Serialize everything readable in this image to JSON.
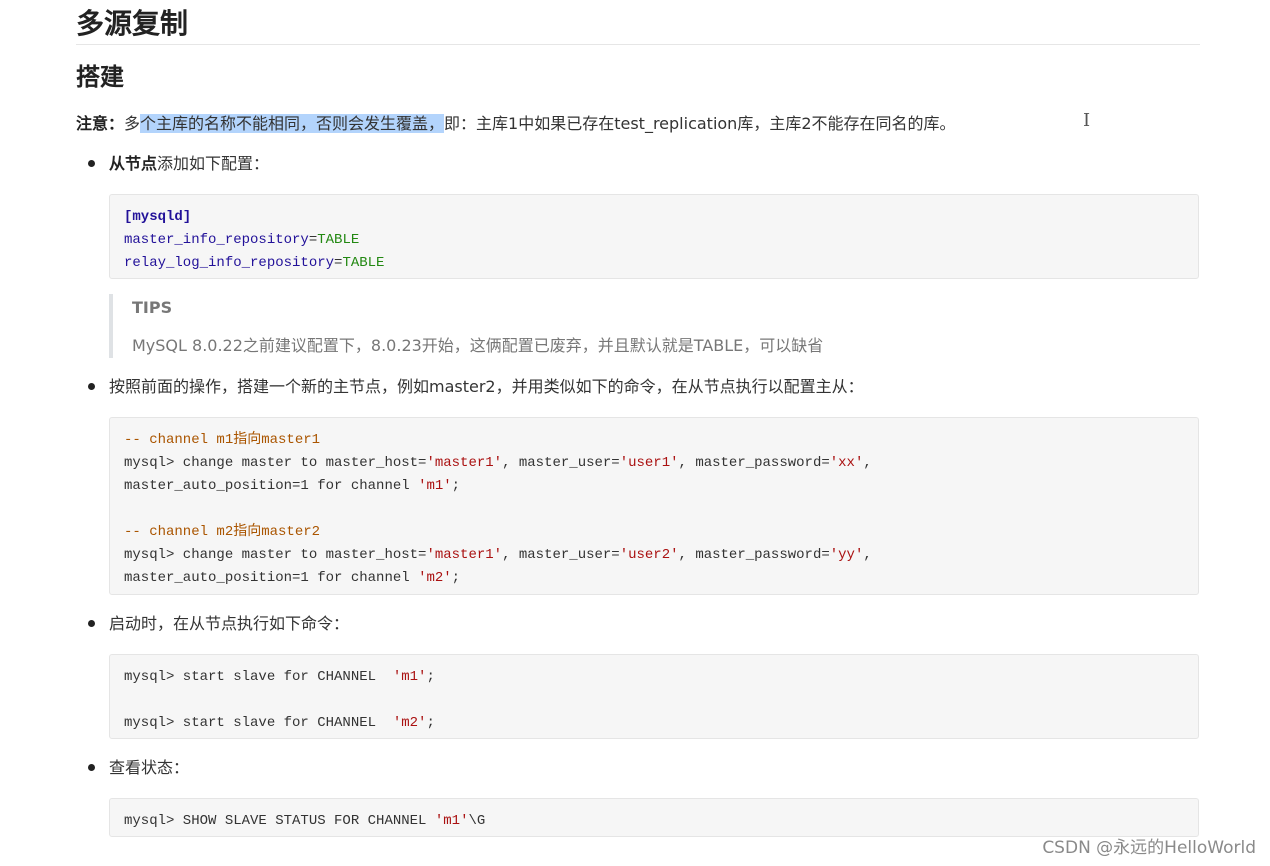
{
  "heading_main": "多源复制",
  "heading_sub": "搭建",
  "note": {
    "label": "注意：",
    "pre": "多",
    "highlight": "个主库的名称不能相同，否则会发生覆盖，",
    "post": "即：主库1中如果已存在test_replication库，主库2不能存在同名的库。"
  },
  "text_cursor_glyph": "I",
  "bullet1": {
    "bold": "从节点",
    "rest": "添加如下配置："
  },
  "code1": {
    "line1": "[mysqld]",
    "line2_key": "master_info_repository",
    "line2_eq": "=",
    "line2_val": "TABLE",
    "line3_key": "relay_log_info_repository",
    "line3_eq": "=",
    "line3_val": "TABLE"
  },
  "tips": {
    "title": "TIPS",
    "text": "MySQL 8.0.22之前建议配置下，8.0.23开始，这俩配置已废弃，并且默认就是TABLE，可以缺省"
  },
  "bullet2": "按照前面的操作，搭建一个新的主节点，例如master2，并用类似如下的命令，在从节点执行以配置主从：",
  "code2": {
    "c1": "-- channel m1指向master1",
    "l1a": "mysql> change master to master_host=",
    "l1s1": "'master1'",
    "l1b": ", master_user=",
    "l1s2": "'user1'",
    "l1c": ", master_password=",
    "l1s3": "'xx'",
    "l1d": ",",
    "l2a": "master_auto_position=1 for channel ",
    "l2s": "'m1'",
    "l2b": ";",
    "c2": "-- channel m2指向master2",
    "l3a": "mysql> change master to master_host=",
    "l3s1": "'master1'",
    "l3b": ", master_user=",
    "l3s2": "'user2'",
    "l3c": ", master_password=",
    "l3s3": "'yy'",
    "l3d": ",",
    "l4a": "master_auto_position=1 for channel ",
    "l4s": "'m2'",
    "l4b": ";"
  },
  "bullet3": "启动时，在从节点执行如下命令：",
  "code3": {
    "l1a": "mysql> start slave for CHANNEL  ",
    "l1s": "'m1'",
    "l1b": ";",
    "l2a": "mysql> start slave for CHANNEL  ",
    "l2s": "'m2'",
    "l2b": ";"
  },
  "bullet4": "查看状态：",
  "code4": {
    "a": "mysql> SHOW SLAVE STATUS FOR CHANNEL ",
    "s": "'m1'",
    "b": "\\G"
  },
  "watermark": "CSDN @永远的HelloWorld"
}
